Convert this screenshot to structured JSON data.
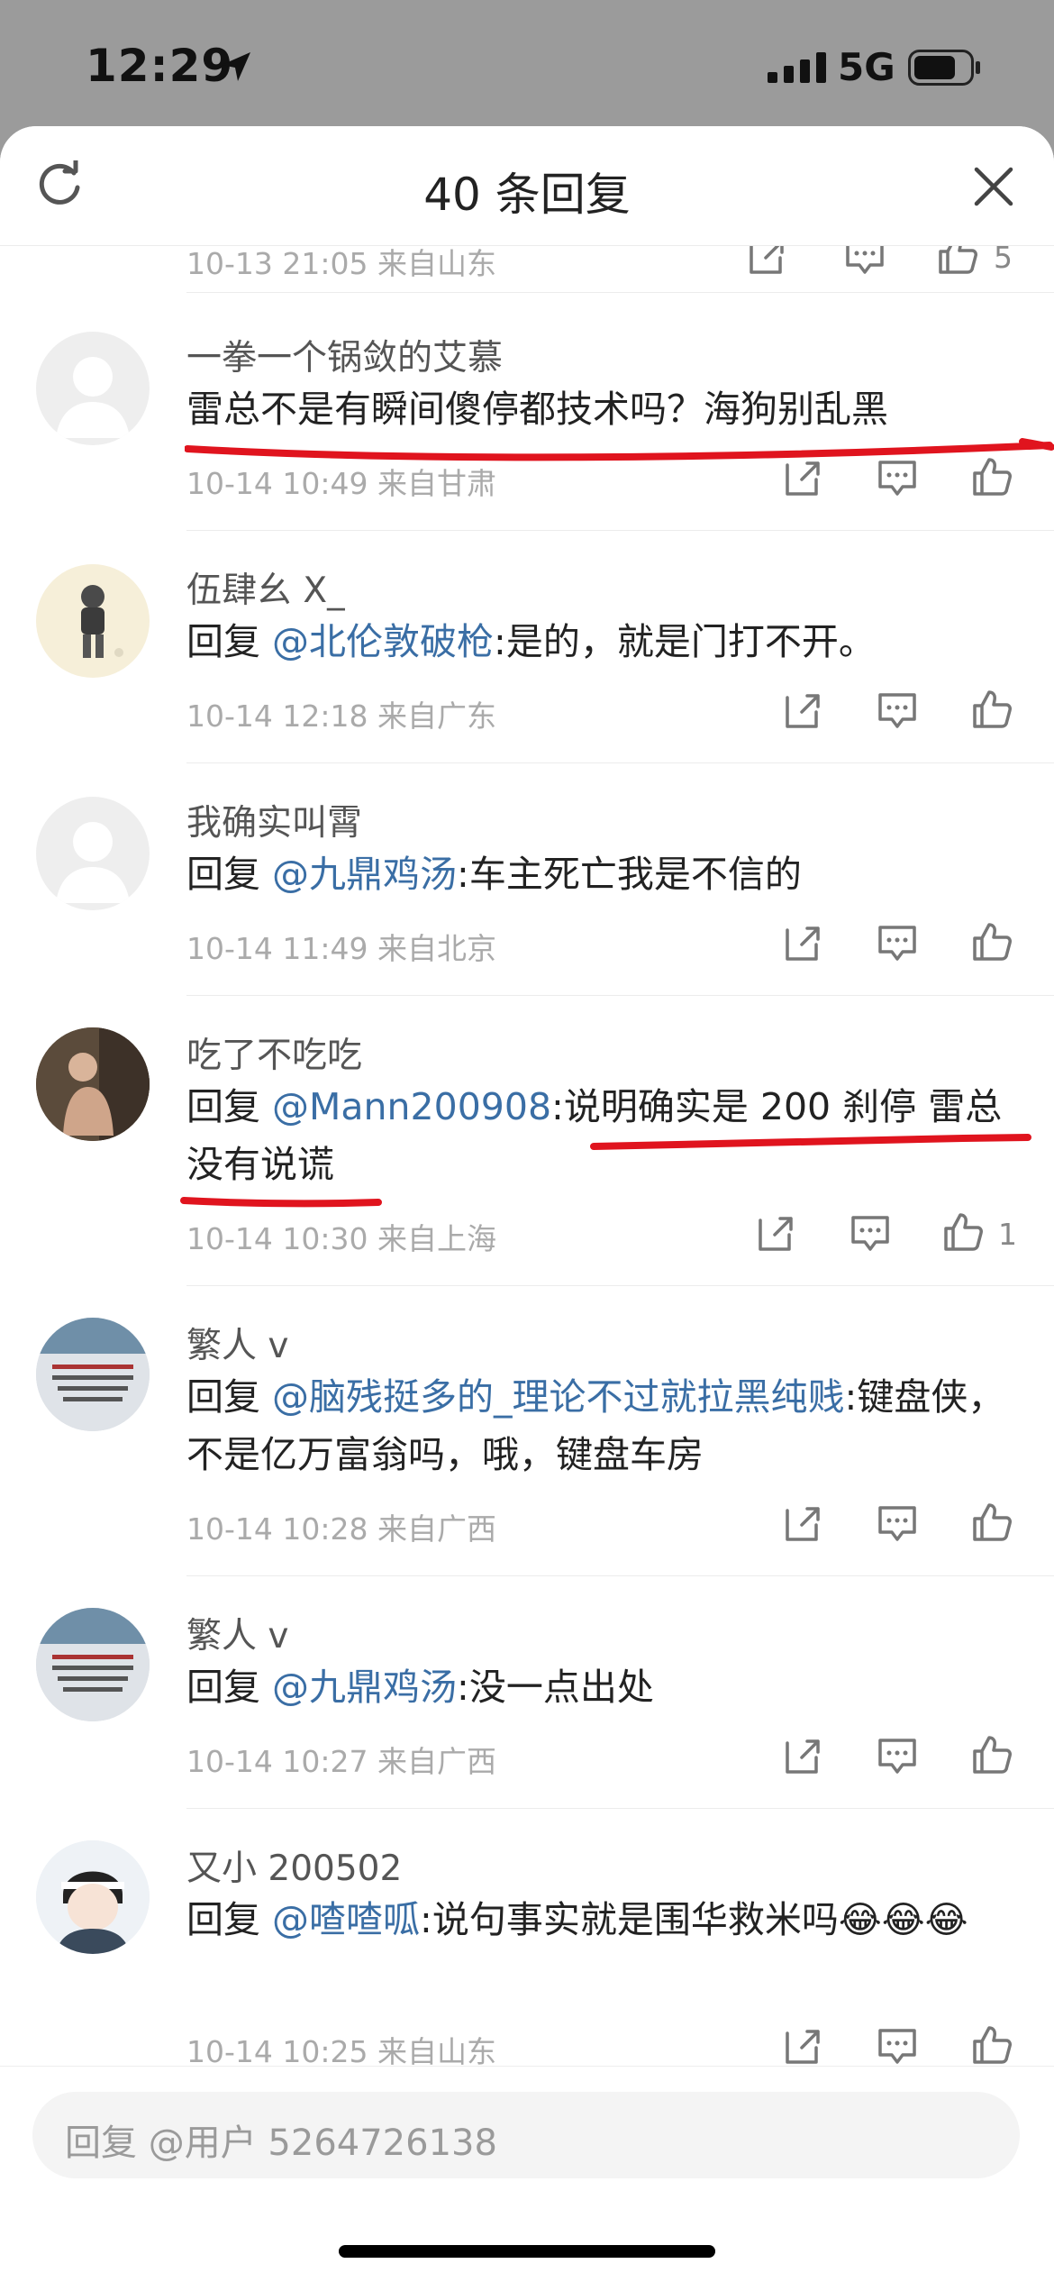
{
  "status_bar": {
    "time": "12:29",
    "network": "5G"
  },
  "header": {
    "title": "40 条回复"
  },
  "top_partial": {
    "meta": "10-13 21:05 来自山东",
    "likes": "5"
  },
  "comments": [
    {
      "user": "一拳一个锅敛的艾慕",
      "prefix": "",
      "mention": "",
      "text": "雷总不是有瞬间傻停都技术吗？海狗别乱黑",
      "meta": "10-14 10:49 来自甘肃",
      "likes": ""
    },
    {
      "user": "伍肆幺 X_",
      "prefix": "回复 ",
      "mention": "@北伦敦破枪",
      "text": ":是的，就是门打不开。",
      "meta": "10-14 12:18 来自广东",
      "likes": ""
    },
    {
      "user": "我确实叫霄",
      "prefix": "回复 ",
      "mention": "@九鼎鸡汤",
      "text": ":车主死亡我是不信的",
      "meta": "10-14 11:49 来自北京",
      "likes": ""
    },
    {
      "user": "吃了不吃吃",
      "prefix": "回复 ",
      "mention": "@Mann200908",
      "text": ":说明确实是 200 刹停 雷总没有说谎",
      "meta": "10-14 10:30 来自上海",
      "likes": "1"
    },
    {
      "user": "繁人 v",
      "prefix": "回复 ",
      "mention": "@脑残挺多的_理论不过就拉黑纯贱",
      "text": ":键盘侠，不是亿万富翁吗，哦，键盘车房",
      "meta": "10-14 10:28 来自广西",
      "likes": ""
    },
    {
      "user": "繁人 v",
      "prefix": "回复 ",
      "mention": "@九鼎鸡汤",
      "text": ":没一点出处",
      "meta": "10-14 10:27 来自广西",
      "likes": ""
    },
    {
      "user": "又小 200502",
      "prefix": "回复 ",
      "mention": "@喳喳呱",
      "text": ":说句事实就是围华救米吗😂😂😂",
      "meta": "10-14 10:25 来自山东",
      "likes": ""
    }
  ],
  "reply_input": {
    "placeholder": "回复 @用户 5264726138"
  },
  "colors": {
    "mention": "#3a6ea5",
    "annotation": "#e0141e",
    "meta": "#aaaaaa"
  },
  "icons": [
    "location-arrow-icon",
    "signal-icon",
    "battery-icon",
    "refresh-icon",
    "close-icon",
    "forward-icon",
    "comment-icon",
    "like-icon"
  ]
}
